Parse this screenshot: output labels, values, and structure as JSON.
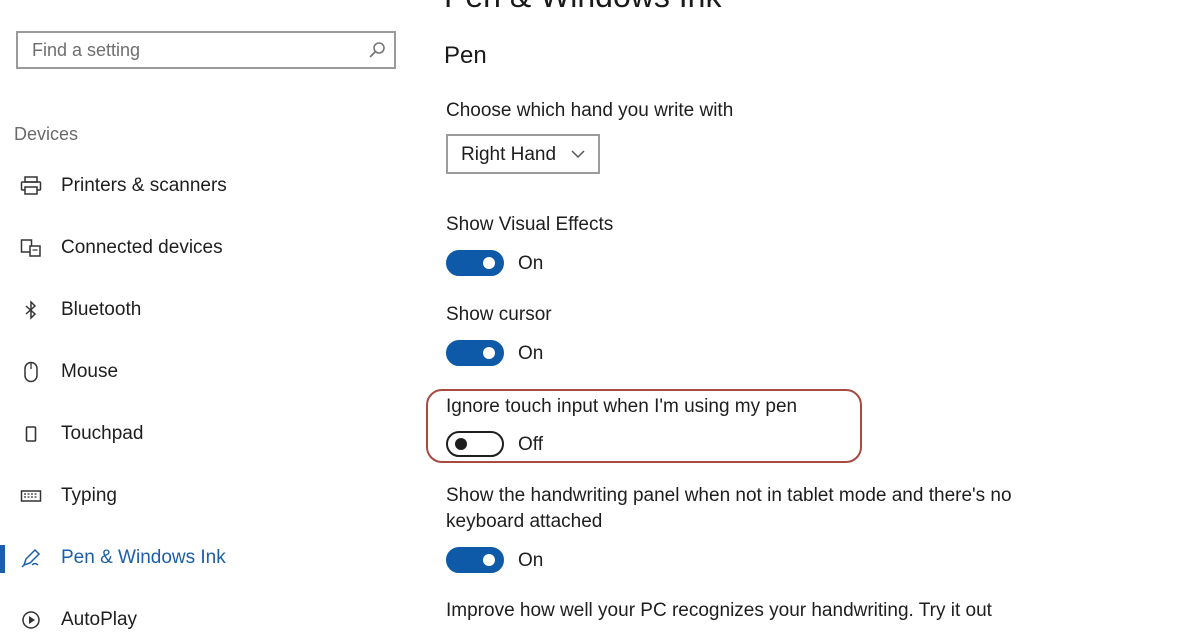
{
  "search": {
    "placeholder": "Find a setting"
  },
  "sidebar": {
    "section": "Devices",
    "items": [
      {
        "label": "Printers & scanners",
        "icon": "printer-icon"
      },
      {
        "label": "Connected devices",
        "icon": "connected-devices-icon"
      },
      {
        "label": "Bluetooth",
        "icon": "bluetooth-icon"
      },
      {
        "label": "Mouse",
        "icon": "mouse-icon"
      },
      {
        "label": "Touchpad",
        "icon": "touchpad-icon"
      },
      {
        "label": "Typing",
        "icon": "keyboard-icon"
      },
      {
        "label": "Pen & Windows Ink",
        "icon": "pen-icon",
        "active": true
      },
      {
        "label": "AutoPlay",
        "icon": "autoplay-icon"
      }
    ]
  },
  "main": {
    "title": "Pen & Windows Ink",
    "section": "Pen",
    "hand": {
      "label": "Choose which hand you write with",
      "value": "Right Hand"
    },
    "visual_effects": {
      "label": "Show Visual Effects",
      "state": "On"
    },
    "cursor": {
      "label": "Show cursor",
      "state": "On"
    },
    "ignore_touch": {
      "label": "Ignore touch input when I'm using my pen",
      "state": "Off"
    },
    "handwriting_panel": {
      "label": "Show the handwriting panel when not in tablet mode and there's no keyboard attached",
      "state": "On"
    },
    "improve": {
      "label": "Improve how well your PC recognizes your handwriting. Try it out"
    }
  },
  "colors": {
    "accent": "#0f5aa8",
    "highlight": "#a84a42"
  }
}
